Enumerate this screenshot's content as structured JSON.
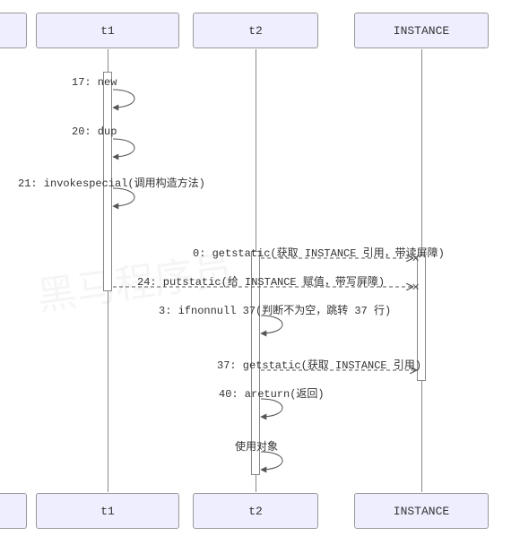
{
  "chart_data": {
    "type": "sequence-diagram",
    "participants": [
      "t1",
      "t2",
      "INSTANCE"
    ],
    "messages": [
      {
        "from": "t1",
        "to": "t1",
        "type": "self",
        "label": "17: new"
      },
      {
        "from": "t1",
        "to": "t1",
        "type": "self",
        "label": "20: dup"
      },
      {
        "from": "t1",
        "to": "t1",
        "type": "self",
        "label": "21: invokespecial(调用构造方法)"
      },
      {
        "from": "t2",
        "to": "INSTANCE",
        "type": "async-blocked",
        "label": "0: getstatic(获取 INSTANCE 引用，带读屏障)"
      },
      {
        "from": "t1",
        "to": "INSTANCE",
        "type": "async-blocked",
        "label": "24: putstatic(给 INSTANCE 赋值，带写屏障)"
      },
      {
        "from": "t2",
        "to": "t2",
        "type": "self",
        "label": "3: ifnonnull 37(判断不为空，跳转 37 行)"
      },
      {
        "from": "t2",
        "to": "INSTANCE",
        "type": "async",
        "label": "37: getstatic(获取 INSTANCE 引用)"
      },
      {
        "from": "t2",
        "to": "t2",
        "type": "self",
        "label": "40: areturn(返回)"
      },
      {
        "from": "t2",
        "to": "t2",
        "type": "self",
        "label": "使用对象"
      }
    ]
  },
  "participants": {
    "t1": "t1",
    "t2": "t2",
    "instance": "INSTANCE"
  },
  "labels": {
    "m1": "17: new",
    "m2": "20: dup",
    "m3": "21: invokespecial(调用构造方法)",
    "m4": "0: getstatic(获取 INSTANCE 引用，带读屏障)",
    "m5": "24: putstatic(给 INSTANCE 赋值，带写屏障)",
    "m6": "3: ifnonnull 37(判断不为空，跳转 37 行)",
    "m7": "37: getstatic(获取 INSTANCE 引用)",
    "m8": "40: areturn(返回)",
    "m9": "使用对象"
  },
  "watermark": "黑马程序员"
}
